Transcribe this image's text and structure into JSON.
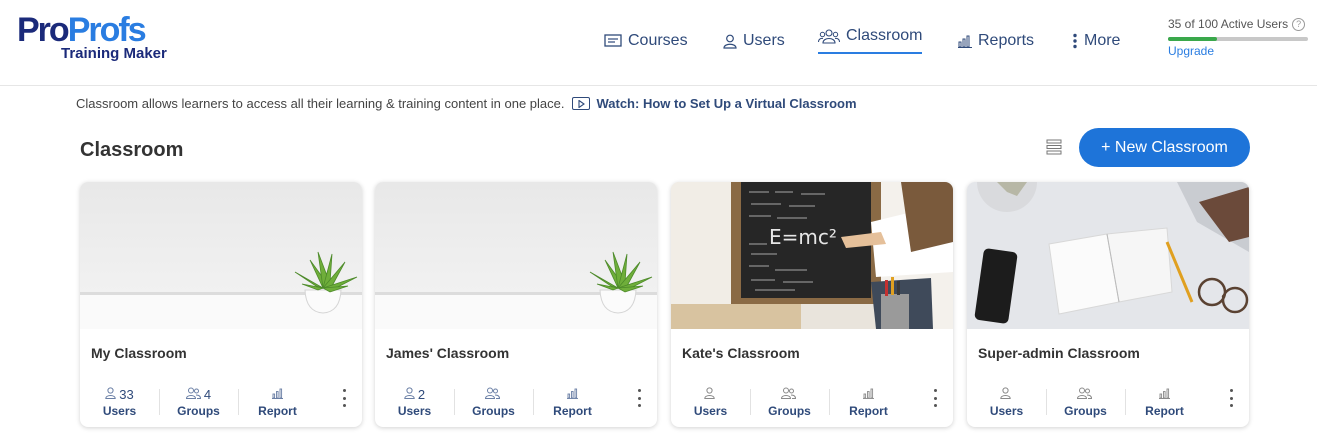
{
  "brand": {
    "part1": "Pro",
    "part2": "Profs",
    "subtitle": "Training Maker"
  },
  "nav": {
    "courses": "Courses",
    "users": "Users",
    "classroom": "Classroom",
    "reports": "Reports",
    "more": "More"
  },
  "usage": {
    "text": "35 of 100 Active Users",
    "fraction": 0.35,
    "upgrade": "Upgrade"
  },
  "info": {
    "text": "Classroom allows learners to access all their learning & training content in one place.",
    "watch": "Watch: How to Set Up a Virtual Classroom"
  },
  "page": {
    "title": "Classroom",
    "new_button": "+ New Classroom"
  },
  "labels": {
    "users": "Users",
    "groups": "Groups",
    "report": "Report"
  },
  "cards": [
    {
      "title": "My Classroom",
      "users": "33",
      "groups": "4"
    },
    {
      "title": "James' Classroom",
      "users": "2",
      "groups": ""
    },
    {
      "title": "Kate's Classroom",
      "users": "",
      "groups": ""
    },
    {
      "title": "Super-admin Classroom",
      "users": "",
      "groups": ""
    }
  ],
  "colors": {
    "accent": "#1e74d9",
    "nav_text": "#2f4a7a",
    "progress": "#3aa84b"
  }
}
